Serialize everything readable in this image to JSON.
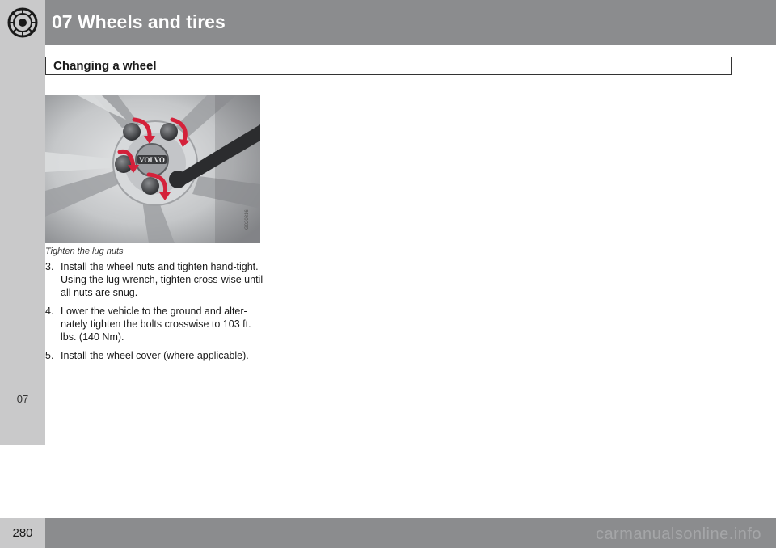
{
  "header": {
    "chapter_title": "07  Wheels and tires",
    "icon": "tire-icon"
  },
  "section": {
    "title": "Changing a wheel"
  },
  "figure": {
    "logo_text": "VOLVO",
    "image_code": "G020816",
    "caption": "Tighten the lug nuts"
  },
  "steps": [
    {
      "number": "3.",
      "text": "Install the wheel nuts and tighten hand-tight. Using the lug wrench, tighten cross-wise until all nuts are snug."
    },
    {
      "number": "4.",
      "text": "Lower the vehicle to the ground and alter-nately tighten the bolts crosswise to 103 ft. lbs. (140 Nm)."
    },
    {
      "number": "5.",
      "text": "Install the wheel cover (where applicable)."
    }
  ],
  "chapter_tab": {
    "label": "07"
  },
  "footer": {
    "page_number": "280",
    "watermark": "carmanualsonline.info"
  },
  "colors": {
    "header_gray": "#8b8c8e",
    "tab_gray": "#c9c9ca",
    "arrow_red": "#d4213a"
  }
}
